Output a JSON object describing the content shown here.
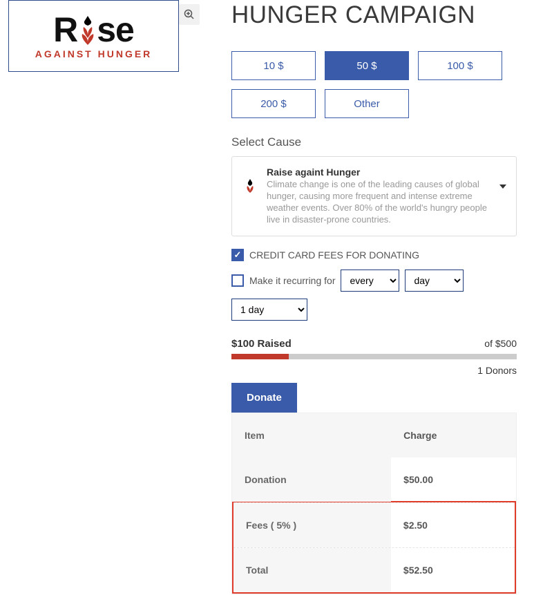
{
  "logo": {
    "text_left": "R",
    "text_right": "se",
    "tagline": "AGAINST HUNGER"
  },
  "title": "HUNGER CAMPAIGN",
  "amounts": {
    "opt1": "10 $",
    "opt2": "50 $",
    "opt3": "100 $",
    "opt4": "200 $",
    "opt5": "Other"
  },
  "cause": {
    "section_label": "Select Cause",
    "title": "Raise againt Hunger",
    "description": "Climate change is one of the leading causes of global hunger, causing more frequent and intense extreme weather events. Over 80% of the world's hungry people live in disaster-prone countries."
  },
  "checkboxes": {
    "cc_fees": "CREDIT CARD FEES FOR DONATING",
    "recurring": "Make it recurring for"
  },
  "selects": {
    "frequency": "every",
    "unit": "day",
    "duration": "1 day"
  },
  "progress": {
    "raised": "$100 Raised",
    "goal": "of $500",
    "donors": "1 Donors"
  },
  "donate_tab": "Donate",
  "breakdown": {
    "header_item": "Item",
    "header_charge": "Charge",
    "donation_label": "Donation",
    "donation_value": "$50.00",
    "fees_label": "Fees ( 5% )",
    "fees_value": "$2.50",
    "total_label": "Total",
    "total_value": "$52.50"
  }
}
